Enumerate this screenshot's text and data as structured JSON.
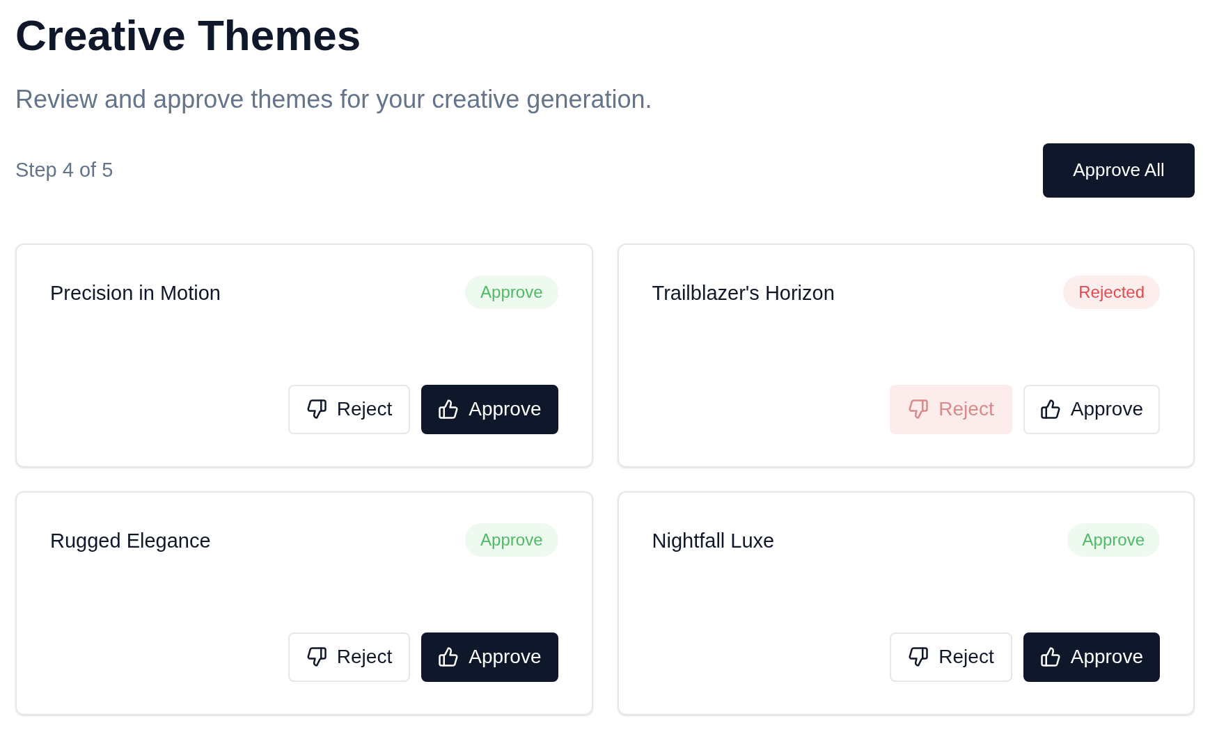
{
  "title": "Creative Themes",
  "subtitle": "Review and approve themes for your creative generation.",
  "step": "Step 4 of 5",
  "approve_all_button": "Approve All",
  "themes": [
    {
      "title": "Precision in Motion",
      "rejected": false,
      "badge": "Approve",
      "reject_button": {
        "label": "Reject",
        "disabled": false
      },
      "approve_button": {
        "label": "Approve",
        "selected": true
      }
    },
    {
      "title": "Trailblazer's Horizon",
      "rejected": true,
      "badge": "Rejected",
      "reject_button": {
        "label": "Reject",
        "disabled": true
      },
      "approve_button": {
        "label": "Approve",
        "selected": false
      }
    },
    {
      "title": "Rugged Elegance",
      "rejected": false,
      "badge": "Approve",
      "reject_button": {
        "label": "Reject",
        "disabled": false
      },
      "approve_button": {
        "label": "Approve",
        "selected": true
      }
    },
    {
      "title": "Nightfall Luxe",
      "rejected": false,
      "badge": "Approve",
      "reject_button": {
        "label": "Reject",
        "disabled": false
      },
      "approve_button": {
        "label": "Approve",
        "selected": true
      }
    }
  ]
}
